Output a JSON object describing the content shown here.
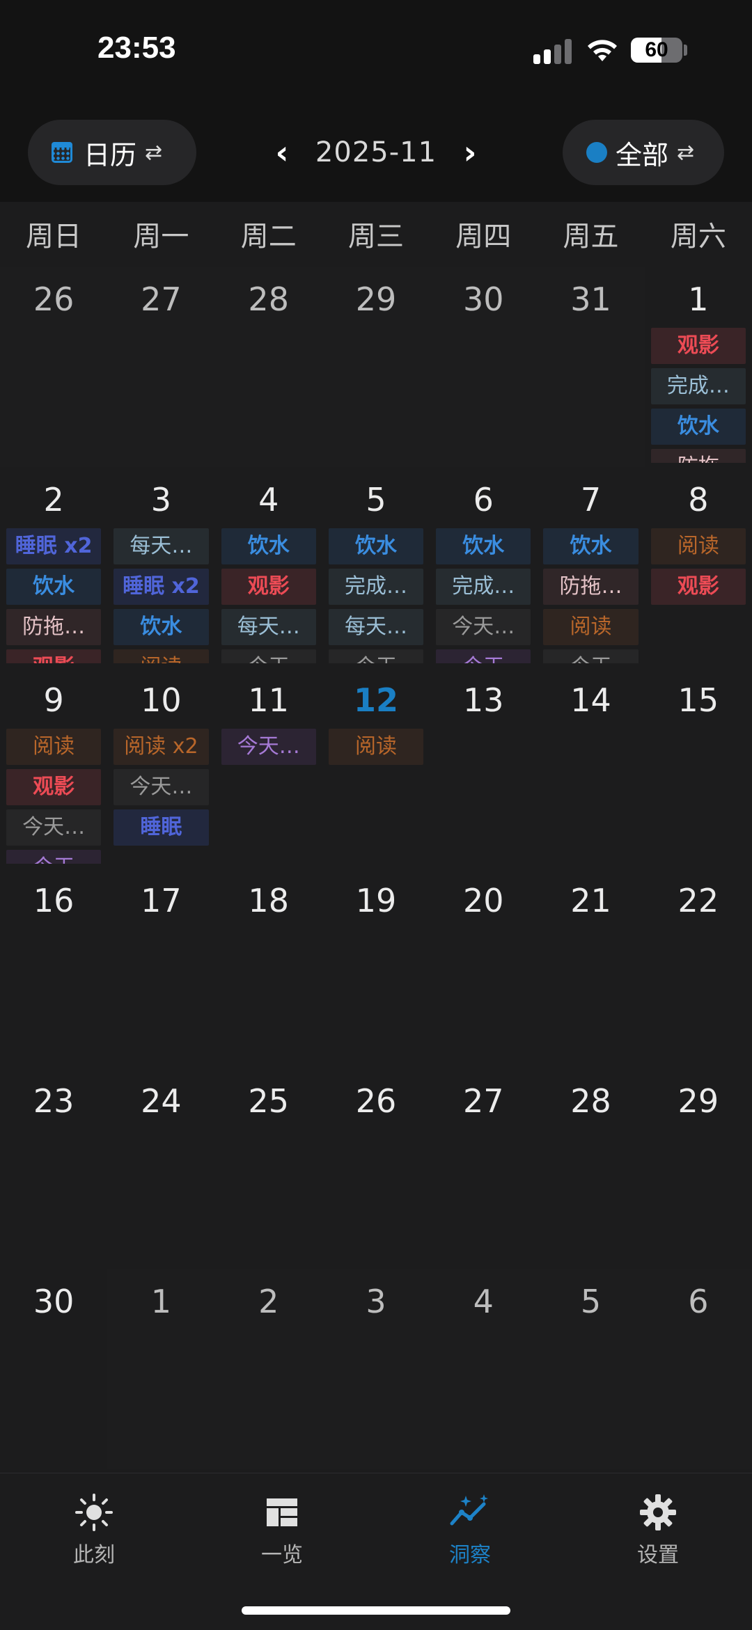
{
  "status": {
    "time": "23:53",
    "battery": "60",
    "battery_level": 0.6
  },
  "header": {
    "view_label": "日历",
    "view_swap_icon": "swap-icon",
    "month": "2025-11",
    "prev_icon": "chevron-left-icon",
    "next_icon": "chevron-right-icon",
    "filter_label": "全部",
    "filter_dot_color": "#1a7fc4"
  },
  "weekdays": [
    "周日",
    "周一",
    "周二",
    "周三",
    "周四",
    "周五",
    "周六"
  ],
  "colors": {
    "red": "#ec4b55",
    "blue": "#3a8de0",
    "indigo": "#5065d9",
    "teal": "#9bbfd6",
    "pink": "#e4c2c6",
    "orange": "#b8662a",
    "gray": "#9a9a9a",
    "purple": "#a67ad6",
    "today": "#1a7fc4",
    "accent": "#1d82c7"
  },
  "weeks": [
    [
      {
        "n": "26",
        "other": true,
        "events": []
      },
      {
        "n": "27",
        "other": true,
        "events": []
      },
      {
        "n": "28",
        "other": true,
        "events": []
      },
      {
        "n": "29",
        "other": true,
        "events": []
      },
      {
        "n": "30",
        "other": true,
        "events": []
      },
      {
        "n": "31",
        "other": true,
        "events": []
      },
      {
        "n": "1",
        "events": [
          {
            "t": "观影",
            "c": "red"
          },
          {
            "t": "完成…",
            "c": "teal"
          },
          {
            "t": "饮水",
            "c": "blue"
          },
          {
            "t": "防拖",
            "c": "pink"
          }
        ]
      }
    ],
    [
      {
        "n": "2",
        "events": [
          {
            "t": "睡眠 x2",
            "c": "indigo"
          },
          {
            "t": "饮水",
            "c": "blue"
          },
          {
            "t": "防拖…",
            "c": "pink"
          },
          {
            "t": "观影",
            "c": "red"
          }
        ]
      },
      {
        "n": "3",
        "events": [
          {
            "t": "每天…",
            "c": "teal"
          },
          {
            "t": "睡眠 x2",
            "c": "indigo"
          },
          {
            "t": "饮水",
            "c": "blue"
          },
          {
            "t": "阅读",
            "c": "orange"
          }
        ]
      },
      {
        "n": "4",
        "events": [
          {
            "t": "饮水",
            "c": "blue"
          },
          {
            "t": "观影",
            "c": "red"
          },
          {
            "t": "每天…",
            "c": "teal"
          },
          {
            "t": "今天",
            "c": "gray"
          }
        ]
      },
      {
        "n": "5",
        "events": [
          {
            "t": "饮水",
            "c": "blue"
          },
          {
            "t": "完成…",
            "c": "teal"
          },
          {
            "t": "每天…",
            "c": "teal"
          },
          {
            "t": "今天",
            "c": "gray"
          }
        ]
      },
      {
        "n": "6",
        "events": [
          {
            "t": "饮水",
            "c": "blue"
          },
          {
            "t": "完成…",
            "c": "teal"
          },
          {
            "t": "今天…",
            "c": "gray"
          },
          {
            "t": "今天",
            "c": "purple"
          }
        ]
      },
      {
        "n": "7",
        "events": [
          {
            "t": "饮水",
            "c": "blue"
          },
          {
            "t": "防拖…",
            "c": "pink"
          },
          {
            "t": "阅读",
            "c": "orange"
          },
          {
            "t": "今天",
            "c": "gray"
          }
        ]
      },
      {
        "n": "8",
        "events": [
          {
            "t": "阅读",
            "c": "orange"
          },
          {
            "t": "观影",
            "c": "red"
          }
        ]
      }
    ],
    [
      {
        "n": "9",
        "events": [
          {
            "t": "阅读",
            "c": "orange"
          },
          {
            "t": "观影",
            "c": "red"
          },
          {
            "t": "今天…",
            "c": "gray"
          },
          {
            "t": "今天",
            "c": "purple"
          }
        ]
      },
      {
        "n": "10",
        "events": [
          {
            "t": "阅读 x2",
            "c": "orange"
          },
          {
            "t": "今天…",
            "c": "gray"
          },
          {
            "t": "睡眠",
            "c": "indigo"
          }
        ]
      },
      {
        "n": "11",
        "events": [
          {
            "t": "今天…",
            "c": "purple"
          }
        ]
      },
      {
        "n": "12",
        "today": true,
        "events": [
          {
            "t": "阅读",
            "c": "orange"
          }
        ]
      },
      {
        "n": "13",
        "events": []
      },
      {
        "n": "14",
        "events": []
      },
      {
        "n": "15",
        "events": []
      }
    ],
    [
      {
        "n": "16",
        "events": []
      },
      {
        "n": "17",
        "events": []
      },
      {
        "n": "18",
        "events": []
      },
      {
        "n": "19",
        "events": []
      },
      {
        "n": "20",
        "events": []
      },
      {
        "n": "21",
        "events": []
      },
      {
        "n": "22",
        "events": []
      }
    ],
    [
      {
        "n": "23",
        "events": []
      },
      {
        "n": "24",
        "events": []
      },
      {
        "n": "25",
        "events": []
      },
      {
        "n": "26",
        "events": []
      },
      {
        "n": "27",
        "events": []
      },
      {
        "n": "28",
        "events": []
      },
      {
        "n": "29",
        "events": []
      }
    ],
    [
      {
        "n": "30",
        "events": []
      },
      {
        "n": "1",
        "other": true,
        "events": []
      },
      {
        "n": "2",
        "other": true,
        "events": []
      },
      {
        "n": "3",
        "other": true,
        "events": []
      },
      {
        "n": "4",
        "other": true,
        "events": []
      },
      {
        "n": "5",
        "other": true,
        "events": []
      },
      {
        "n": "6",
        "other": true,
        "events": []
      }
    ]
  ],
  "tabs": [
    {
      "label": "此刻",
      "icon": "sun-icon",
      "active": false
    },
    {
      "label": "一览",
      "icon": "dashboard-icon",
      "active": false
    },
    {
      "label": "洞察",
      "icon": "trend-sparkle-icon",
      "active": true
    },
    {
      "label": "设置",
      "icon": "gear-icon",
      "active": false
    }
  ]
}
